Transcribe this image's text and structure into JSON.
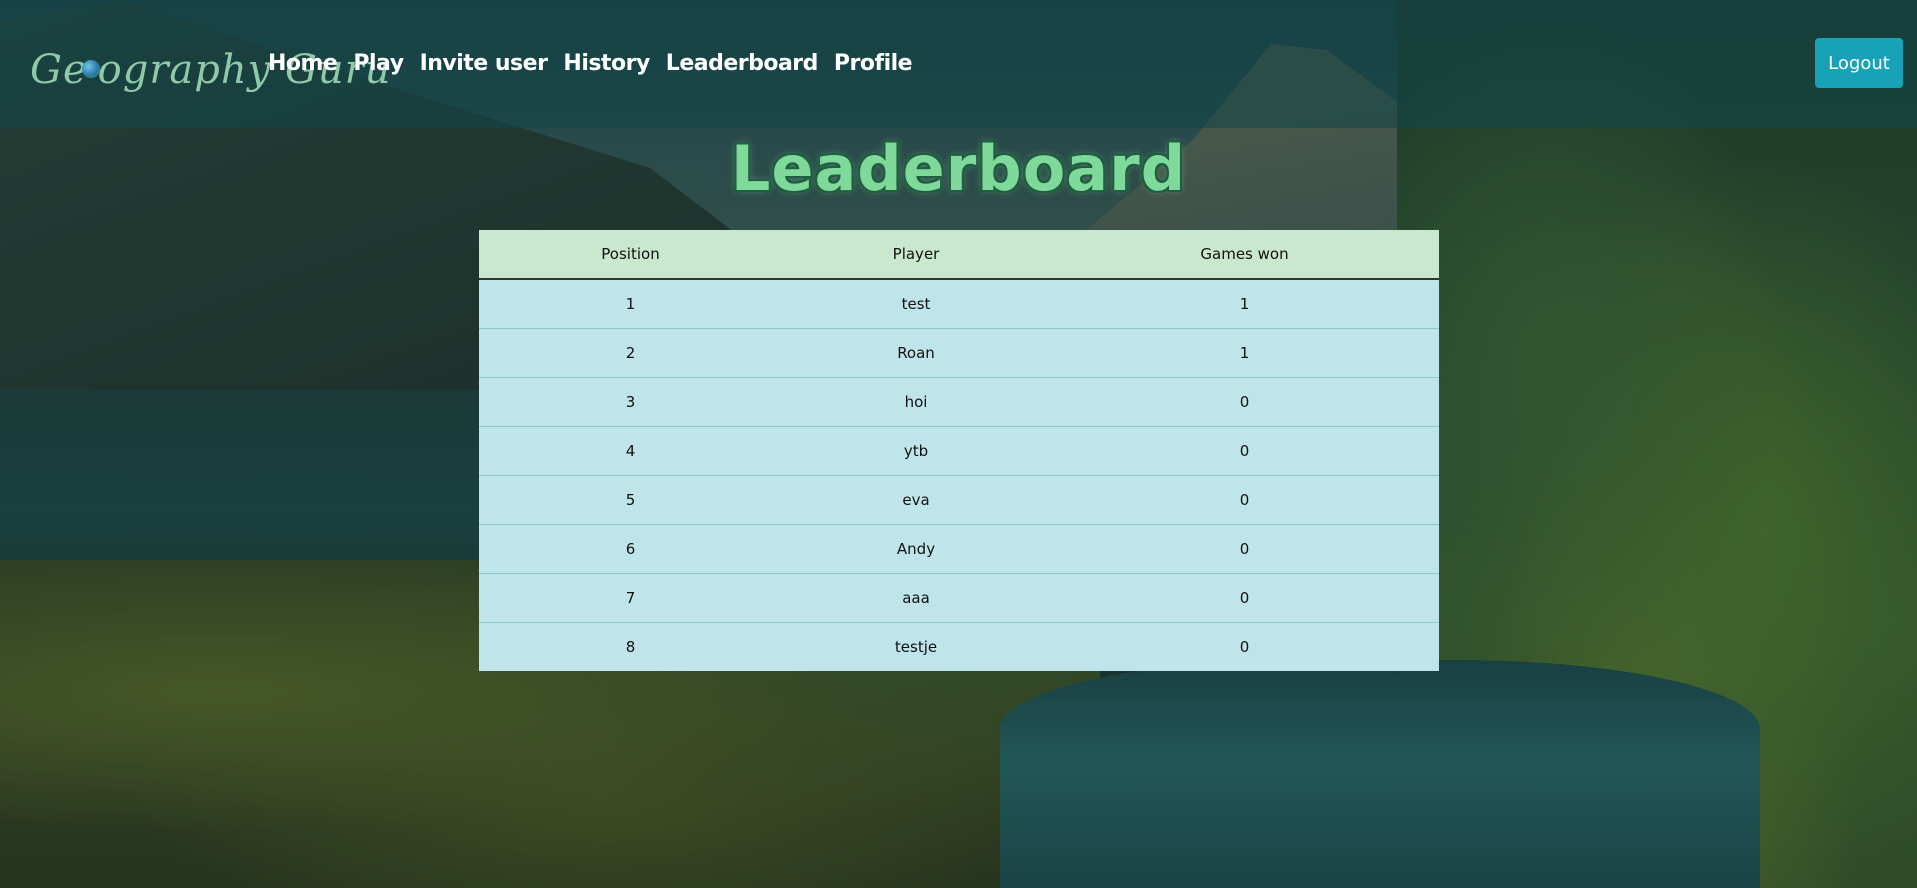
{
  "navbar": {
    "brand": "Geography Guru",
    "links": [
      {
        "label": "Home"
      },
      {
        "label": "Play"
      },
      {
        "label": "Invite user"
      },
      {
        "label": "History"
      },
      {
        "label": "Leaderboard"
      },
      {
        "label": "Profile"
      }
    ],
    "logout_label": "Logout"
  },
  "page": {
    "title": "Leaderboard"
  },
  "leaderboard": {
    "columns": [
      "Position",
      "Player",
      "Games won"
    ],
    "rows": [
      {
        "position": "1",
        "player": "test",
        "games_won": "1"
      },
      {
        "position": "2",
        "player": "Roan",
        "games_won": "1"
      },
      {
        "position": "3",
        "player": "hoi",
        "games_won": "0"
      },
      {
        "position": "4",
        "player": "ytb",
        "games_won": "0"
      },
      {
        "position": "5",
        "player": "eva",
        "games_won": "0"
      },
      {
        "position": "6",
        "player": "Andy",
        "games_won": "0"
      },
      {
        "position": "7",
        "player": "aaa",
        "games_won": "0"
      },
      {
        "position": "8",
        "player": "testje",
        "games_won": "0"
      }
    ]
  },
  "colors": {
    "accent": "#17a2b8",
    "title_green": "#7ed99a",
    "header_row": "#c9e8cd",
    "body_row": "#bfe5ea"
  }
}
